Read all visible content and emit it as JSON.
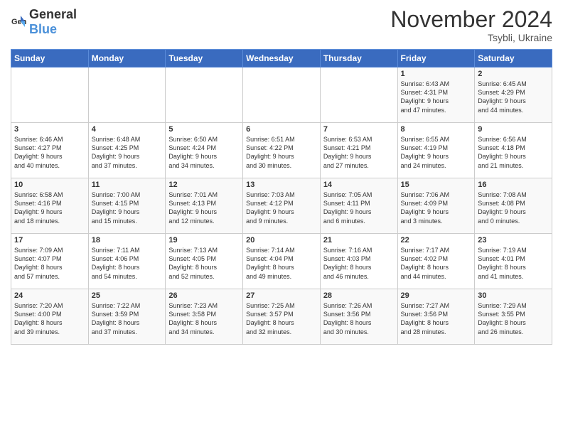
{
  "header": {
    "logo_general": "General",
    "logo_blue": "Blue",
    "month_title": "November 2024",
    "location": "Tsybli, Ukraine"
  },
  "days_of_week": [
    "Sunday",
    "Monday",
    "Tuesday",
    "Wednesday",
    "Thursday",
    "Friday",
    "Saturday"
  ],
  "weeks": [
    [
      {
        "day": "",
        "info": ""
      },
      {
        "day": "",
        "info": ""
      },
      {
        "day": "",
        "info": ""
      },
      {
        "day": "",
        "info": ""
      },
      {
        "day": "",
        "info": ""
      },
      {
        "day": "1",
        "info": "Sunrise: 6:43 AM\nSunset: 4:31 PM\nDaylight: 9 hours\nand 47 minutes."
      },
      {
        "day": "2",
        "info": "Sunrise: 6:45 AM\nSunset: 4:29 PM\nDaylight: 9 hours\nand 44 minutes."
      }
    ],
    [
      {
        "day": "3",
        "info": "Sunrise: 6:46 AM\nSunset: 4:27 PM\nDaylight: 9 hours\nand 40 minutes."
      },
      {
        "day": "4",
        "info": "Sunrise: 6:48 AM\nSunset: 4:25 PM\nDaylight: 9 hours\nand 37 minutes."
      },
      {
        "day": "5",
        "info": "Sunrise: 6:50 AM\nSunset: 4:24 PM\nDaylight: 9 hours\nand 34 minutes."
      },
      {
        "day": "6",
        "info": "Sunrise: 6:51 AM\nSunset: 4:22 PM\nDaylight: 9 hours\nand 30 minutes."
      },
      {
        "day": "7",
        "info": "Sunrise: 6:53 AM\nSunset: 4:21 PM\nDaylight: 9 hours\nand 27 minutes."
      },
      {
        "day": "8",
        "info": "Sunrise: 6:55 AM\nSunset: 4:19 PM\nDaylight: 9 hours\nand 24 minutes."
      },
      {
        "day": "9",
        "info": "Sunrise: 6:56 AM\nSunset: 4:18 PM\nDaylight: 9 hours\nand 21 minutes."
      }
    ],
    [
      {
        "day": "10",
        "info": "Sunrise: 6:58 AM\nSunset: 4:16 PM\nDaylight: 9 hours\nand 18 minutes."
      },
      {
        "day": "11",
        "info": "Sunrise: 7:00 AM\nSunset: 4:15 PM\nDaylight: 9 hours\nand 15 minutes."
      },
      {
        "day": "12",
        "info": "Sunrise: 7:01 AM\nSunset: 4:13 PM\nDaylight: 9 hours\nand 12 minutes."
      },
      {
        "day": "13",
        "info": "Sunrise: 7:03 AM\nSunset: 4:12 PM\nDaylight: 9 hours\nand 9 minutes."
      },
      {
        "day": "14",
        "info": "Sunrise: 7:05 AM\nSunset: 4:11 PM\nDaylight: 9 hours\nand 6 minutes."
      },
      {
        "day": "15",
        "info": "Sunrise: 7:06 AM\nSunset: 4:09 PM\nDaylight: 9 hours\nand 3 minutes."
      },
      {
        "day": "16",
        "info": "Sunrise: 7:08 AM\nSunset: 4:08 PM\nDaylight: 9 hours\nand 0 minutes."
      }
    ],
    [
      {
        "day": "17",
        "info": "Sunrise: 7:09 AM\nSunset: 4:07 PM\nDaylight: 8 hours\nand 57 minutes."
      },
      {
        "day": "18",
        "info": "Sunrise: 7:11 AM\nSunset: 4:06 PM\nDaylight: 8 hours\nand 54 minutes."
      },
      {
        "day": "19",
        "info": "Sunrise: 7:13 AM\nSunset: 4:05 PM\nDaylight: 8 hours\nand 52 minutes."
      },
      {
        "day": "20",
        "info": "Sunrise: 7:14 AM\nSunset: 4:04 PM\nDaylight: 8 hours\nand 49 minutes."
      },
      {
        "day": "21",
        "info": "Sunrise: 7:16 AM\nSunset: 4:03 PM\nDaylight: 8 hours\nand 46 minutes."
      },
      {
        "day": "22",
        "info": "Sunrise: 7:17 AM\nSunset: 4:02 PM\nDaylight: 8 hours\nand 44 minutes."
      },
      {
        "day": "23",
        "info": "Sunrise: 7:19 AM\nSunset: 4:01 PM\nDaylight: 8 hours\nand 41 minutes."
      }
    ],
    [
      {
        "day": "24",
        "info": "Sunrise: 7:20 AM\nSunset: 4:00 PM\nDaylight: 8 hours\nand 39 minutes."
      },
      {
        "day": "25",
        "info": "Sunrise: 7:22 AM\nSunset: 3:59 PM\nDaylight: 8 hours\nand 37 minutes."
      },
      {
        "day": "26",
        "info": "Sunrise: 7:23 AM\nSunset: 3:58 PM\nDaylight: 8 hours\nand 34 minutes."
      },
      {
        "day": "27",
        "info": "Sunrise: 7:25 AM\nSunset: 3:57 PM\nDaylight: 8 hours\nand 32 minutes."
      },
      {
        "day": "28",
        "info": "Sunrise: 7:26 AM\nSunset: 3:56 PM\nDaylight: 8 hours\nand 30 minutes."
      },
      {
        "day": "29",
        "info": "Sunrise: 7:27 AM\nSunset: 3:56 PM\nDaylight: 8 hours\nand 28 minutes."
      },
      {
        "day": "30",
        "info": "Sunrise: 7:29 AM\nSunset: 3:55 PM\nDaylight: 8 hours\nand 26 minutes."
      }
    ]
  ]
}
